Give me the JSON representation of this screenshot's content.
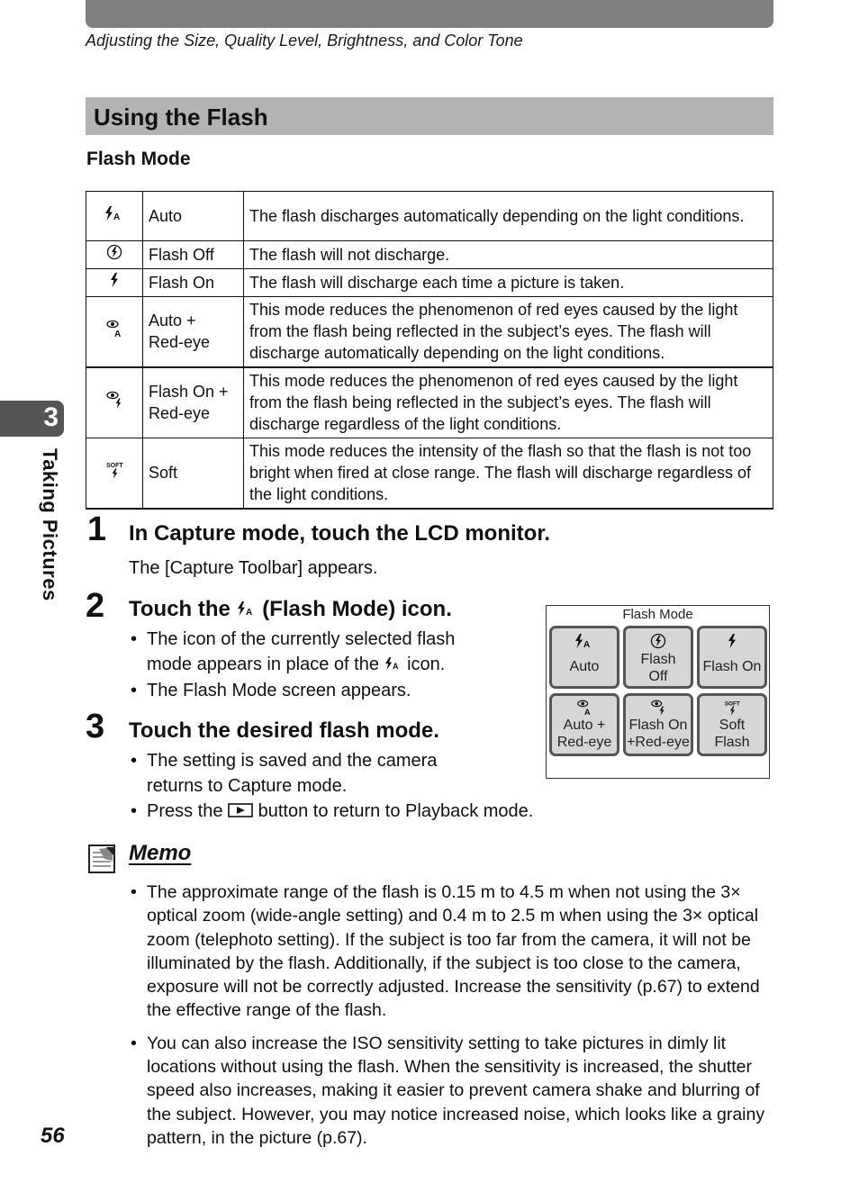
{
  "header": {
    "running_head": "Adjusting the Size, Quality Level, Brightness, and Color Tone"
  },
  "section": {
    "title": "Using the Flash",
    "subtitle": "Flash Mode"
  },
  "flash_modes_table": [
    {
      "icon": "flash-auto-icon",
      "name": "Auto",
      "description": "The flash discharges automatically depending on the light conditions."
    },
    {
      "icon": "flash-off-icon",
      "name": "Flash Off",
      "description": "The flash will not discharge."
    },
    {
      "icon": "flash-on-icon",
      "name": "Flash On",
      "description": "The flash will discharge each time a picture is taken."
    },
    {
      "icon": "auto-red-eye-icon",
      "name_line1": "Auto +",
      "name_line2": "Red-eye",
      "description": "This mode reduces the phenomenon of red eyes caused by the light from the flash being reflected in the subject’s eyes. The flash will discharge automatically depending on the light conditions."
    },
    {
      "icon": "flash-on-red-eye-icon",
      "name_line1": "Flash On +",
      "name_line2": "Red-eye",
      "description": "This mode reduces the phenomenon of red eyes caused by the light from the flash being reflected in the subject’s eyes. The flash will discharge regardless of the light conditions."
    },
    {
      "icon": "soft-flash-icon",
      "name": "Soft",
      "description": "This mode reduces the intensity of the flash so that the flash is not too bright when fired at close range. The flash will discharge regardless of the light conditions."
    }
  ],
  "side_tab": {
    "chapter_number": "3",
    "chapter_label": "Taking Pictures"
  },
  "steps": [
    {
      "number": "1",
      "heading": "In Capture mode, touch the LCD monitor.",
      "text": "The [Capture Toolbar] appears."
    },
    {
      "number": "2",
      "heading_before": "Touch the",
      "heading_after": "(Flash Mode) icon.",
      "bullets": [
        {
          "line1": "The icon of the currently selected flash",
          "line2_before": "mode appears in place of the",
          "line2_after": "icon."
        },
        {
          "text": "The Flash Mode screen appears."
        }
      ]
    },
    {
      "number": "3",
      "heading": "Touch the desired flash mode.",
      "bullets": [
        {
          "line1": "The setting is saved and the camera",
          "line2": "returns to Capture mode."
        },
        {
          "before": "Press the",
          "after": "button to return to Playback mode."
        }
      ]
    }
  ],
  "flash_mode_screen": {
    "title": "Flash Mode",
    "buttons": [
      {
        "icon": "flash-auto-icon",
        "label_line1": "Auto",
        "label_line2": ""
      },
      {
        "icon": "flash-off-icon",
        "label_line1": "Flash",
        "label_line2": "Off"
      },
      {
        "icon": "flash-on-icon",
        "label_line1": "Flash On",
        "label_line2": ""
      },
      {
        "icon": "auto-red-eye-icon",
        "label_line1": "Auto +",
        "label_line2": "Red-eye"
      },
      {
        "icon": "flash-on-red-eye-icon",
        "label_line1": "Flash On",
        "label_line2": "+Red-eye"
      },
      {
        "icon": "soft-flash-icon",
        "label_line1": "Soft",
        "label_line2": "Flash"
      }
    ]
  },
  "memo": {
    "title": "Memo",
    "items": [
      "The approximate range of the flash is 0.15 m to 4.5 m when not using the 3× optical zoom (wide-angle setting) and 0.4 m to 2.5 m when using the 3× optical zoom (telephoto setting). If the subject is too far from the camera, it will not be illuminated by the flash. Additionally, if the subject is too close to the camera, exposure will not be correctly adjusted. Increase the sensitivity (p.67) to extend the effective range of the flash.",
      "You can also increase the ISO sensitivity setting to take pictures in dimly lit locations without using the flash. When the sensitivity is increased, the shutter speed also increases, making it easier to prevent camera shake and blurring of the subject. However, you may notice increased noise, which looks like a grainy pattern, in the picture (p.67)."
    ]
  },
  "page_number": "56",
  "colors": {
    "top_bar": "#808080",
    "section_band": "#b3b3b3",
    "side_tab": "#555555",
    "button_fill": "#d6d6d6"
  }
}
